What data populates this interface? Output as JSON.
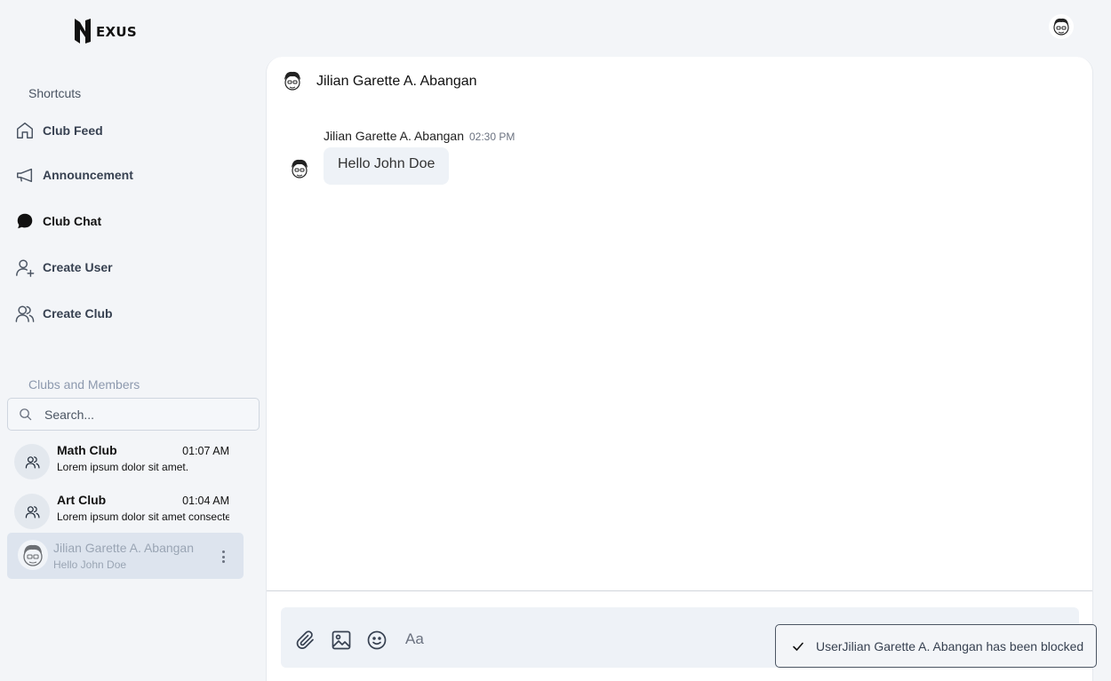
{
  "app": {
    "logo_text": "EXUS"
  },
  "sidebar": {
    "shortcuts_label": "Shortcuts",
    "nav": [
      {
        "label": "Club Feed",
        "icon": "home-icon"
      },
      {
        "label": "Announcement",
        "icon": "megaphone-icon"
      },
      {
        "label": "Club Chat",
        "icon": "chat-bubble-icon",
        "active": true
      },
      {
        "label": "Create User",
        "icon": "user-plus-icon"
      },
      {
        "label": "Create Club",
        "icon": "users-icon"
      }
    ],
    "clubs_label": "Clubs and Members",
    "search": {
      "placeholder": "Search..."
    },
    "conversations": [
      {
        "name": "Math Club",
        "time": "01:07 AM",
        "preview": "Lorem ipsum dolor sit amet."
      },
      {
        "name": "Art Club",
        "time": "01:04 AM",
        "preview": "Lorem ipsum dolor sit amet consectetur"
      },
      {
        "name": "Jilian Garette A. Abangan",
        "preview": "Hello John Doe",
        "selected": true
      }
    ]
  },
  "chat": {
    "header_name": "Jilian Garette A. Abangan",
    "messages": [
      {
        "sender": "Jilian Garette A. Abangan",
        "time": "02:30 PM",
        "text": "Hello John Doe"
      }
    ],
    "composer": {
      "placeholder": "Aa"
    }
  },
  "toast": {
    "text": "UserJilian Garette A. Abangan has been blocked"
  }
}
